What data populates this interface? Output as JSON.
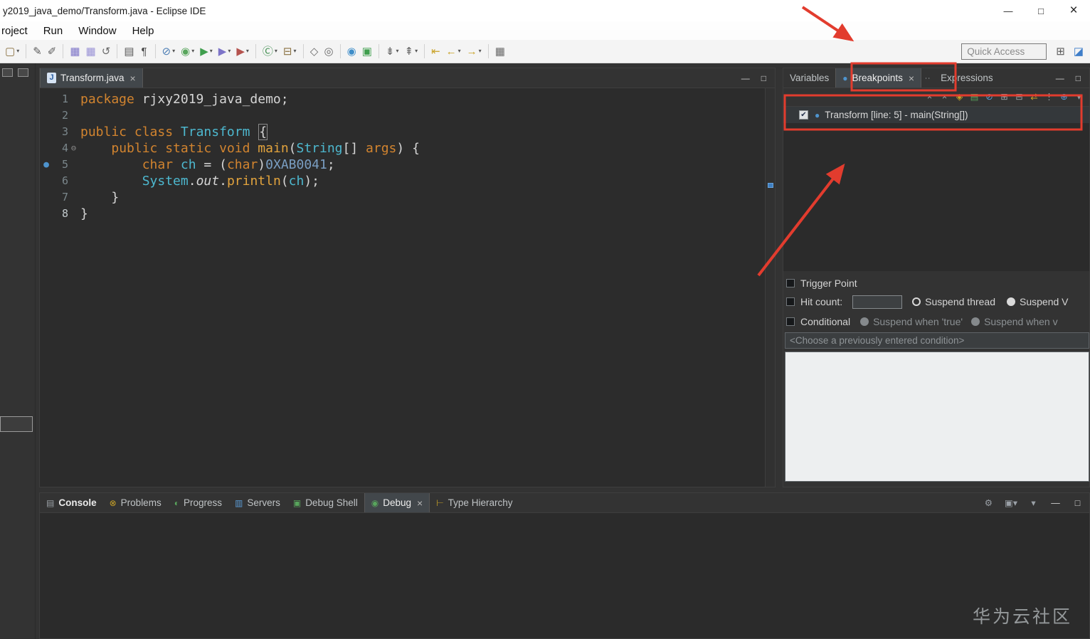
{
  "titlebar": {
    "title": "y2019_java_demo/Transform.java - Eclipse IDE"
  },
  "glyphs": {
    "minimize": "—",
    "maximize": "□",
    "close": "×",
    "caret": "▾",
    "dot": "●",
    "fold": "⊖",
    "check": "✔",
    "overflow": "∙∙"
  },
  "colors": {
    "annotation_red": "#e23c2e",
    "breakpoint_blue": "#4e94ce",
    "keyword_orange": "#d2842f",
    "type_cyan": "#4db8cf"
  },
  "menubar": {
    "items": [
      "roject",
      "Run",
      "Window",
      "Help"
    ]
  },
  "toolbar": {
    "quick_access_label": "Quick Access",
    "icons": [
      {
        "n": "new-wizard-icon",
        "g": "▢",
        "c": "#8a7040",
        "caret": true
      },
      {
        "sep": true
      },
      {
        "n": "pen-icon",
        "g": "✎",
        "c": "#5a5a5a"
      },
      {
        "n": "marker-icon",
        "g": "✐",
        "c": "#5a5a5a"
      },
      {
        "sep": true
      },
      {
        "n": "save-icon",
        "g": "▦",
        "c": "#7d74c8"
      },
      {
        "n": "save-all-icon",
        "g": "▦",
        "c": "#9a93d6"
      },
      {
        "n": "revert-icon",
        "g": "↺",
        "c": "#6a6a6a"
      },
      {
        "sep": true
      },
      {
        "n": "print-icon",
        "g": "▤",
        "c": "#5a5a5a"
      },
      {
        "n": "pilcrow-icon",
        "g": "¶",
        "c": "#4a4a4a"
      },
      {
        "sep": true
      },
      {
        "n": "skip-breakpoints-icon",
        "g": "⊘",
        "c": "#4e7fb5",
        "caret": true
      },
      {
        "n": "debug-launch-icon",
        "g": "◉",
        "c": "#58a55c",
        "caret": true
      },
      {
        "n": "run-icon",
        "g": "▶",
        "c": "#3f9e4d",
        "caret": true
      },
      {
        "n": "coverage-icon",
        "g": "▶",
        "c": "#7d74c8",
        "caret": true
      },
      {
        "n": "profile-icon",
        "g": "▶",
        "c": "#b5534e",
        "caret": true
      },
      {
        "sep": true
      },
      {
        "n": "new-java-class-icon",
        "g": "Ⓒ",
        "c": "#3f8e4f",
        "caret": true
      },
      {
        "n": "new-java-package-icon",
        "g": "⊟",
        "c": "#8a7040",
        "caret": true
      },
      {
        "sep": true
      },
      {
        "n": "open-type-icon",
        "g": "◇",
        "c": "#6a6a6a"
      },
      {
        "n": "search-icon",
        "g": "◎",
        "c": "#6a6a6a"
      },
      {
        "sep": true
      },
      {
        "n": "web-browser-icon",
        "g": "◉",
        "c": "#3f8ec9"
      },
      {
        "n": "terminal-icon",
        "g": "▣",
        "c": "#3f9e4d"
      },
      {
        "sep": true
      },
      {
        "n": "next-annotation-icon",
        "g": "⇟",
        "c": "#6a6a6a",
        "caret": true
      },
      {
        "n": "prev-annotation-icon",
        "g": "⇞",
        "c": "#6a6a6a",
        "caret": true
      },
      {
        "sep": true
      },
      {
        "n": "last-edit-location-icon",
        "g": "⇤",
        "c": "#c9a227"
      },
      {
        "n": "back-icon",
        "g": "←",
        "c": "#c9a227",
        "caret": true
      },
      {
        "n": "forward-icon",
        "g": "→",
        "c": "#c9a227",
        "caret": true
      },
      {
        "sep": true
      },
      {
        "n": "open-editor-icon",
        "g": "▦",
        "c": "#6a6a6a"
      }
    ],
    "perspective_icons": [
      {
        "n": "open-perspective-icon",
        "g": "⊞",
        "c": "#5a5a5a"
      },
      {
        "n": "java-perspective-icon",
        "g": "◪",
        "c": "#3f7ec9"
      }
    ]
  },
  "editor": {
    "tab_label": "Transform.java",
    "tab_icon": "J",
    "close": "×",
    "lines": [
      {
        "num": "1",
        "tokens": [
          [
            "kw",
            "package"
          ],
          [
            "pl",
            " rjxy2019_java_demo;"
          ]
        ]
      },
      {
        "num": "2",
        "tokens": []
      },
      {
        "num": "3",
        "tokens": [
          [
            "kw",
            "public"
          ],
          [
            "pl",
            " "
          ],
          [
            "kw",
            "class"
          ],
          [
            "cl",
            " Transform"
          ],
          [
            "pl",
            " "
          ],
          [
            "br",
            "{"
          ]
        ]
      },
      {
        "num": "4",
        "fold": true,
        "tokens": [
          [
            "pl",
            "    "
          ],
          [
            "kw",
            "public"
          ],
          [
            "pl",
            " "
          ],
          [
            "kw",
            "static"
          ],
          [
            "pl",
            " "
          ],
          [
            "kw",
            "void"
          ],
          [
            "me",
            " main"
          ],
          [
            "pl",
            "("
          ],
          [
            "cl",
            "String"
          ],
          [
            "pl",
            "[] "
          ],
          [
            "va",
            "args"
          ],
          [
            "pl",
            ") {"
          ]
        ]
      },
      {
        "num": "5",
        "bp": true,
        "tokens": [
          [
            "pl",
            "        "
          ],
          [
            "kw",
            "char"
          ],
          [
            "cl",
            " ch"
          ],
          [
            "pl",
            " = ("
          ],
          [
            "kw",
            "char"
          ],
          [
            "pl",
            ")"
          ],
          [
            "nu",
            "0XAB0041"
          ],
          [
            "pl",
            ";"
          ]
        ]
      },
      {
        "num": "6",
        "tokens": [
          [
            "pl",
            "        "
          ],
          [
            "cl",
            "System"
          ],
          [
            "pl",
            "."
          ],
          [
            "it",
            "out"
          ],
          [
            "pl",
            "."
          ],
          [
            "me",
            "println"
          ],
          [
            "pl",
            "("
          ],
          [
            "cl",
            "ch"
          ],
          [
            "pl",
            ");"
          ]
        ]
      },
      {
        "num": "7",
        "tokens": [
          [
            "pl",
            "    }"
          ]
        ]
      },
      {
        "num": "8",
        "cur": true,
        "tokens": [
          [
            "pl",
            "}"
          ]
        ]
      }
    ]
  },
  "breakpoints": {
    "tabs": [
      {
        "label": "Variables"
      },
      {
        "label": "Breakpoints",
        "active": true,
        "close": "×",
        "icon": {
          "n": "breakpoints-icon",
          "g": "●",
          "c": "#4e94ce"
        }
      },
      {
        "overflow": true
      },
      {
        "label": "Expressions"
      }
    ],
    "toolbar_icons": [
      {
        "n": "remove-breakpoint-icon",
        "g": "×",
        "c": "#9aa0a6"
      },
      {
        "n": "remove-all-breakpoints-icon",
        "g": "×",
        "c": "#9aa0a6"
      },
      {
        "n": "show-supported-breakpoints-icon",
        "g": "◈",
        "c": "#c9a227"
      },
      {
        "n": "go-to-file-icon",
        "g": "▤",
        "c": "#58a55c"
      },
      {
        "n": "skip-all-breakpoints-icon",
        "g": "⊘",
        "c": "#5b9bd5"
      },
      {
        "n": "expand-all-icon",
        "g": "⊞",
        "c": "#9aa0a6"
      },
      {
        "n": "collapse-all-icon",
        "g": "⊟",
        "c": "#9aa0a6"
      },
      {
        "n": "link-with-debug-view-icon",
        "g": "⇄",
        "c": "#c9a227"
      },
      {
        "n": "group-by-icon",
        "g": "⋮",
        "c": "#9aa0a6"
      },
      {
        "n": "add-exception-breakpoint-icon",
        "g": "⊕",
        "c": "#5b9bd5"
      },
      {
        "n": "view-menu-icon",
        "g": "▾",
        "c": "#9aa0a6"
      }
    ],
    "entry": {
      "checked": true,
      "label": "Transform [line: 5] - main(String[])"
    },
    "detail": {
      "trigger_point": "Trigger Point",
      "hit_count": "Hit count:",
      "suspend_thread": "Suspend thread",
      "suspend_vm": "Suspend V",
      "conditional": "Conditional",
      "suspend_true": "Suspend when 'true'",
      "suspend_change": "Suspend when v",
      "combo_placeholder": "<Choose a previously entered condition>"
    }
  },
  "console": {
    "tabs": [
      {
        "label": "Console",
        "bold": true,
        "icon": {
          "n": "console-icon",
          "g": "▤",
          "c": "#9aa0a6"
        }
      },
      {
        "label": "Problems",
        "icon": {
          "n": "problems-icon",
          "g": "⊗",
          "c": "#c9a227"
        }
      },
      {
        "label": "Progress",
        "icon": {
          "n": "progress-icon",
          "g": "◐",
          "c": "#58a55c"
        }
      },
      {
        "label": "Servers",
        "icon": {
          "n": "servers-icon",
          "g": "▥",
          "c": "#5b9bd5"
        }
      },
      {
        "label": "Debug Shell",
        "icon": {
          "n": "debug-shell-icon",
          "g": "▣",
          "c": "#58a55c"
        }
      },
      {
        "label": "Debug",
        "active": true,
        "close": "×",
        "icon": {
          "n": "debug-icon",
          "g": "◉",
          "c": "#58a55c"
        }
      },
      {
        "label": "Type Hierarchy",
        "icon": {
          "n": "type-hierarchy-icon",
          "g": "⊢",
          "c": "#c9a227"
        }
      }
    ],
    "corner_icons": [
      {
        "n": "wrench-icon",
        "g": "⚙",
        "c": "#9aa0a6"
      },
      {
        "n": "open-console-icon",
        "g": "▣",
        "c": "#9aa0a6",
        "caret": true
      },
      {
        "n": "console-view-menu-icon",
        "g": "▾",
        "c": "#9aa0a6"
      },
      {
        "n": "minimize-view-icon",
        "g": "—",
        "c": "#cfcfcf"
      },
      {
        "n": "maximize-view-icon",
        "g": "□",
        "c": "#cfcfcf"
      }
    ],
    "watermark": "华为云社区"
  }
}
